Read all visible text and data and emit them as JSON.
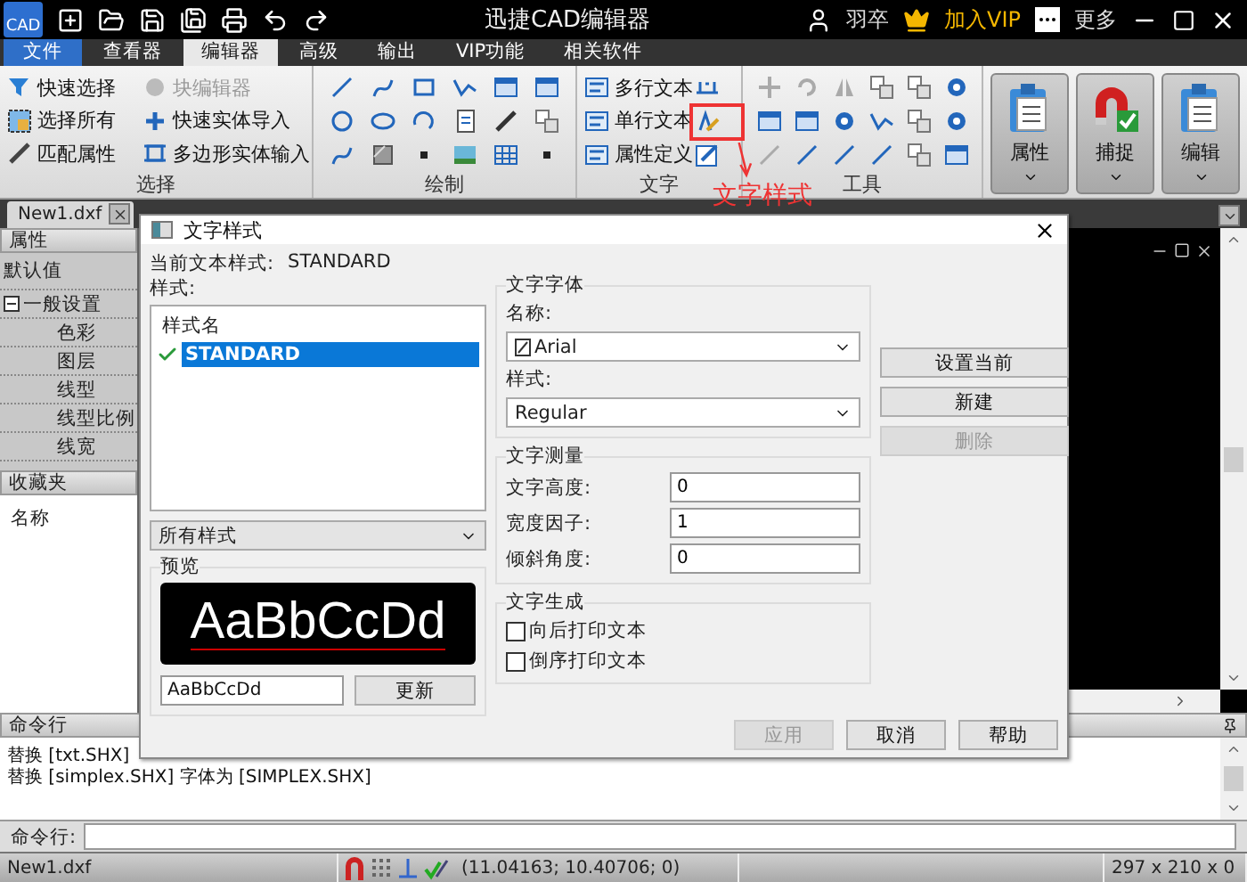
{
  "window": {
    "logo": "CAD",
    "title": "迅捷CAD编辑器",
    "user": "羽卒",
    "vip": "加入VIP",
    "more": "更多"
  },
  "menu_tabs": [
    {
      "label": "文件",
      "kind": "file",
      "selected": false
    },
    {
      "label": "查看器",
      "kind": "tab",
      "selected": false
    },
    {
      "label": "编辑器",
      "kind": "tab",
      "selected": true
    },
    {
      "label": "高级",
      "kind": "tab",
      "selected": false
    },
    {
      "label": "输出",
      "kind": "tab",
      "selected": false
    },
    {
      "label": "VIP功能",
      "kind": "tab",
      "selected": false
    },
    {
      "label": "相关软件",
      "kind": "tab",
      "selected": false
    }
  ],
  "ribbon": {
    "select": {
      "label": "选择",
      "commands": [
        {
          "label": "快速选择",
          "disabled": false
        },
        {
          "label": "块编辑器",
          "disabled": true
        },
        {
          "label": "选择所有",
          "disabled": false
        },
        {
          "label": "快速实体导入",
          "disabled": false
        },
        {
          "label": "匹配属性",
          "disabled": false
        },
        {
          "label": "多边形实体输入",
          "disabled": false
        }
      ]
    },
    "draw": {
      "label": "绘制"
    },
    "text": {
      "label": "文字",
      "commands": [
        {
          "label": "多行文本"
        },
        {
          "label": "单行文本"
        },
        {
          "label": "属性定义"
        }
      ]
    },
    "tools": {
      "label": "工具"
    },
    "big_buttons": [
      {
        "label": "属性",
        "kind": "clipboard"
      },
      {
        "label": "捕捉",
        "kind": "magnet"
      },
      {
        "label": "编辑",
        "kind": "clipboard"
      }
    ]
  },
  "annotation": {
    "label": "文字样式"
  },
  "doc_tabs": [
    {
      "label": "New1.dxf",
      "selected": true
    }
  ],
  "properties": {
    "header": "属性",
    "default": "默认值",
    "section": {
      "label": "一般设置",
      "expanded": true,
      "children": [
        {
          "label": "色彩"
        },
        {
          "label": "图层"
        },
        {
          "label": "线型"
        },
        {
          "label": "线型比例"
        },
        {
          "label": "线宽"
        }
      ]
    }
  },
  "favorites": {
    "header": "收藏夹",
    "column": "名称"
  },
  "command": {
    "header": "命令行",
    "lines": [
      "替换 [txt.SHX]",
      "替换 [simplex.SHX] 字体为 [SIMPLEX.SHX]"
    ],
    "prompt": "命令行:"
  },
  "status_bar": {
    "file": "New1.dxf",
    "coords": "(11.04163; 10.40706; 0)",
    "size": "297 x 210 x 0"
  },
  "dialog": {
    "title": "文字样式",
    "current_label": "当前文本样式:",
    "current_value": "STANDARD",
    "styles_label": "样式:",
    "list_header": "样式名",
    "styles": [
      {
        "name": "STANDARD",
        "selected": true,
        "current": true
      }
    ],
    "filter": "所有样式",
    "preview": {
      "label": "预览",
      "sample": "AaBbCcDd",
      "text": "AaBbCcDd",
      "update": "更新"
    },
    "font": {
      "label": "文字字体",
      "name_label": "名称:",
      "name": "Arial",
      "style_label": "样式:",
      "style": "Regular"
    },
    "measure": {
      "label": "文字测量",
      "fields": [
        {
          "label": "文字高度:",
          "value": "0"
        },
        {
          "label": "宽度因子:",
          "value": "1"
        },
        {
          "label": "倾斜角度:",
          "value": "0"
        }
      ]
    },
    "generation": {
      "label": "文字生成",
      "options": [
        {
          "label": "向后打印文本",
          "checked": false
        },
        {
          "label": "倒序打印文本",
          "checked": false
        }
      ]
    },
    "side_buttons": [
      {
        "label": "设置当前",
        "disabled": false
      },
      {
        "label": "新建",
        "disabled": false
      },
      {
        "label": "删除",
        "disabled": true
      }
    ],
    "buttons": [
      {
        "label": "应用",
        "disabled": true
      },
      {
        "label": "取消",
        "disabled": false
      },
      {
        "label": "帮助",
        "disabled": false
      }
    ]
  }
}
